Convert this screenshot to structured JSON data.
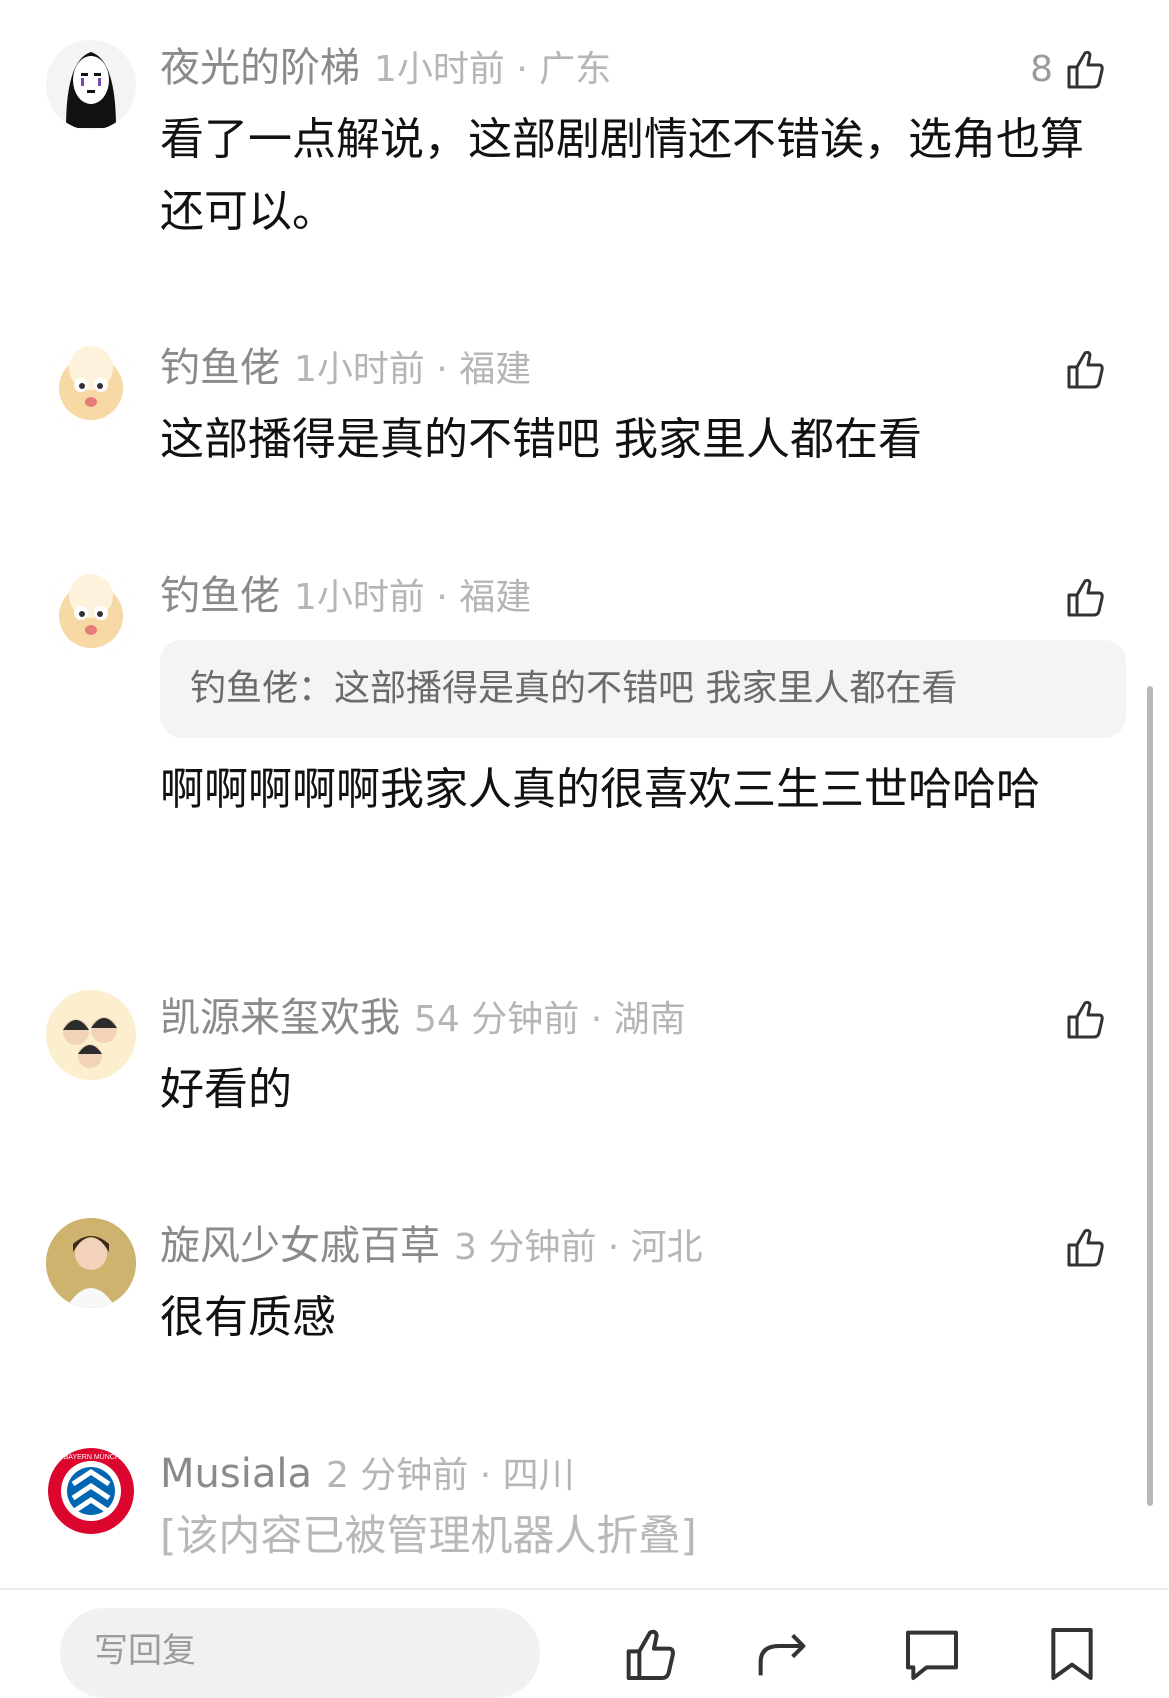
{
  "comments": [
    {
      "name": "夜光的阶梯",
      "time": "1小时前 · 广东",
      "text": "看了一点解说，这部剧剧情还不错诶，选角也算还可以。",
      "likes": "8"
    },
    {
      "name": "钓鱼佬",
      "time": "1小时前 · 福建",
      "text": "这部播得是真的不错吧 我家里人都在看",
      "likes": ""
    },
    {
      "name": "钓鱼佬",
      "time": "1小时前 · 福建",
      "quote": "钓鱼佬：这部播得是真的不错吧 我家里人都在看",
      "text": "啊啊啊啊啊我家人真的很喜欢三生三世哈哈哈",
      "likes": ""
    },
    {
      "name": "凯源来玺欢我",
      "time": "54 分钟前 · 湖南",
      "text": "好看的",
      "likes": ""
    },
    {
      "name": "旋风少女戚百草",
      "time": "3 分钟前 · 河北",
      "text": "很有质感",
      "likes": ""
    },
    {
      "name": "Musiala",
      "time": "2 分钟前 · 四川",
      "folded": "[该内容已被管理机器人折叠]",
      "badge_text": "FC BAYERN MÜNCHEN"
    }
  ],
  "bottom_bar": {
    "reply_placeholder": "写回复",
    "icons": [
      "thumbs-up-icon",
      "share-icon",
      "comment-icon",
      "bookmark-icon"
    ]
  },
  "colors": {
    "name": "#8a8a8a",
    "time": "#b5b5b5",
    "text": "#111111",
    "quote_bg": "#f4f4f4",
    "folded": "#b8b8b8"
  }
}
